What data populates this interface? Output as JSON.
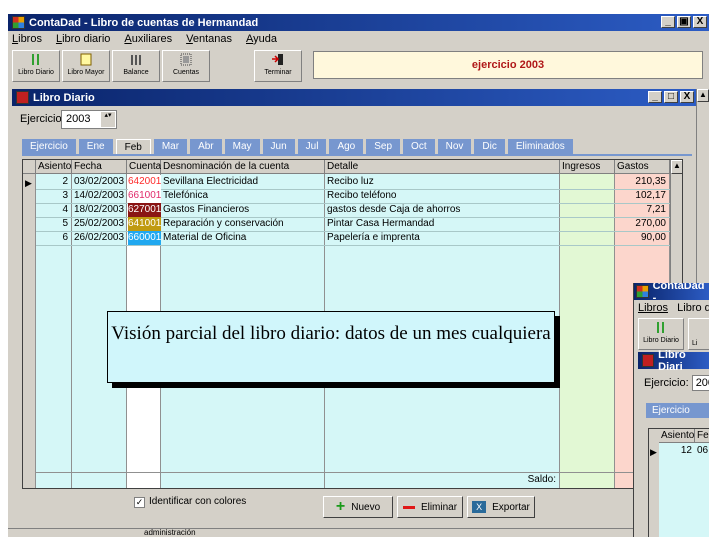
{
  "app": {
    "title": "ContaDad - Libro de cuentas de Hermandad",
    "min": "_",
    "max": "❐",
    "close": "X"
  },
  "menu": [
    "Libros",
    "Libro diario",
    "Auxiliares",
    "Ventanas",
    "Ayuda"
  ],
  "toolbar": {
    "buttons": [
      "Libro Diario",
      "Libro Mayor",
      "Balance",
      "Cuentas",
      "Terminar"
    ],
    "year_banner": "ejercicio 2003"
  },
  "libro": {
    "title": "Libro Diario",
    "ejercicio_label": "Ejercicio:",
    "ejercicio_value": "2003",
    "spin": "▴▾"
  },
  "tabs": [
    "Ejercicio",
    "Ene",
    "Feb",
    "Mar",
    "Abr",
    "May",
    "Jun",
    "Jul",
    "Ago",
    "Sep",
    "Oct",
    "Nov",
    "Dic",
    "Eliminados"
  ],
  "active_tab": "Feb",
  "table": {
    "headers": [
      "Asiento",
      "Fecha",
      "Cuenta",
      "Desnominación de la cuenta",
      "Detalle",
      "Ingresos",
      "Gastos"
    ],
    "rows": [
      {
        "asiento": "2",
        "fecha": "03/02/2003",
        "cuenta": "642001",
        "cuenta_fg": "#ff2a2a",
        "cuenta_bg": "#ffffff",
        "nombre": "Sevillana Electricidad",
        "detalle": "Recibo luz",
        "ingresos": "",
        "gastos": "210,35"
      },
      {
        "asiento": "3",
        "fecha": "14/02/2003",
        "cuenta": "661001",
        "cuenta_fg": "#e02a6a",
        "cuenta_bg": "#ffffff",
        "nombre": "Telefónica",
        "detalle": "Recibo teléfono",
        "ingresos": "",
        "gastos": "102,17"
      },
      {
        "asiento": "4",
        "fecha": "18/02/2003",
        "cuenta": "627001",
        "cuenta_fg": "#ffffff",
        "cuenta_bg": "#8a1414",
        "nombre": "Gastos Financieros",
        "detalle": "gastos desde Caja de ahorros",
        "ingresos": "",
        "gastos": "7,21"
      },
      {
        "asiento": "5",
        "fecha": "25/02/2003",
        "cuenta": "641001",
        "cuenta_fg": "#ffffff",
        "cuenta_bg": "#c09a10",
        "nombre": "Reparación y conservación",
        "detalle": "Pintar Casa Hermandad",
        "ingresos": "",
        "gastos": "270,00"
      },
      {
        "asiento": "6",
        "fecha": "26/02/2003",
        "cuenta": "660001",
        "cuenta_fg": "#ffffff",
        "cuenta_bg": "#20a8f0",
        "nombre": "Material de Oficina",
        "detalle": "Papelería e imprenta",
        "ingresos": "",
        "gastos": "90,00"
      }
    ],
    "saldo_label": "Saldo:"
  },
  "footer": {
    "checkbox_label": "Identificar con colores",
    "nuevo": "Nuevo",
    "eliminar": "Eliminar",
    "exportar": "Exportar",
    "status": "administración"
  },
  "callout": "Visión parcial del libro diario: datos de un mes cualquiera",
  "overlay": {
    "app_title": "ContaDad -",
    "menu1": "Libros",
    "menu2": "Libro d",
    "btn1": "Libro Diario",
    "btn2": "Li",
    "libro_title": "Libro Diari",
    "ejercicio_label": "Ejercicio:",
    "ejercicio_value": "200",
    "tab": "Ejercicio",
    "h1": "Asiento",
    "h2": "Fe",
    "asiento": "12",
    "fecha": "06,"
  }
}
